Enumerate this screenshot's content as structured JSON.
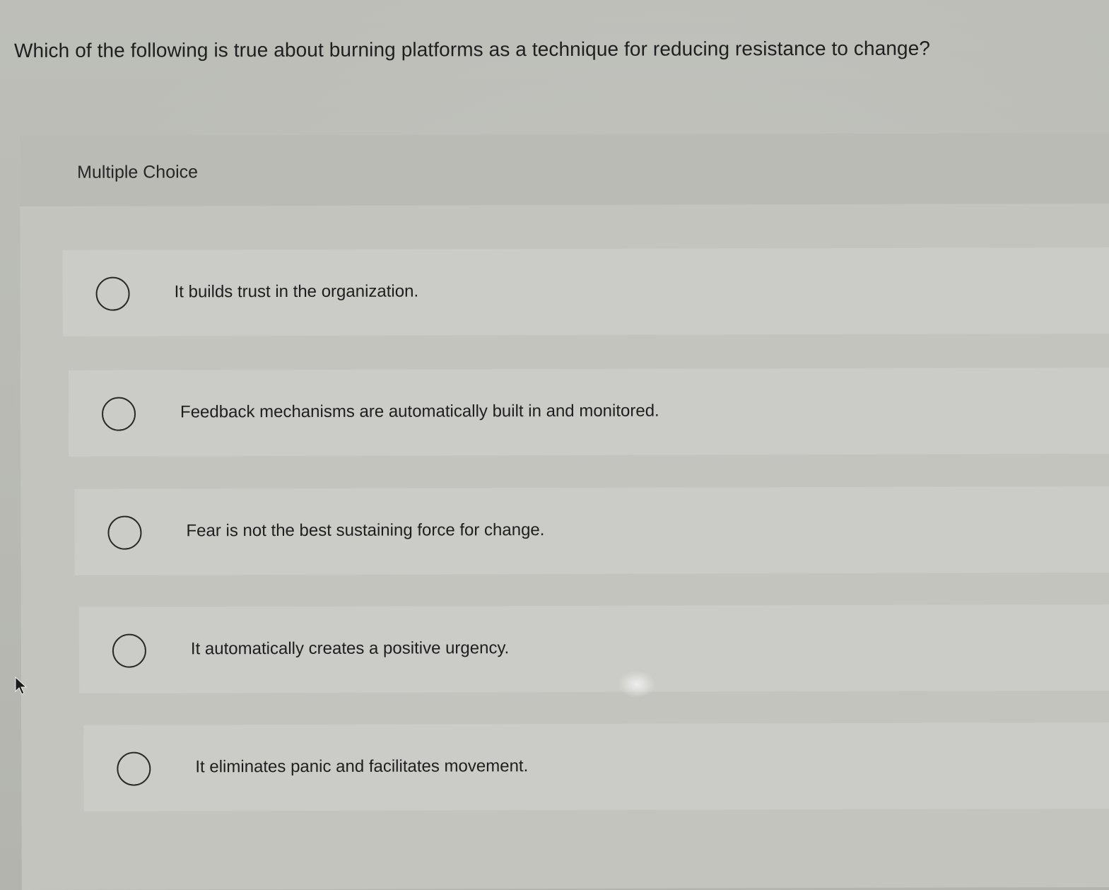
{
  "question": {
    "text": "Which of the following is true about burning platforms as a technique for reducing resistance to change?"
  },
  "multiple_choice": {
    "title": "Multiple Choice",
    "options": [
      {
        "label": "It builds trust in the organization."
      },
      {
        "label": "Feedback mechanisms are automatically built in and monitored."
      },
      {
        "label": "Fear is not the best sustaining force for change."
      },
      {
        "label": "It automatically creates a positive urgency."
      },
      {
        "label": "It eliminates panic and facilitates movement."
      }
    ]
  },
  "icons": {
    "radio": "radio-button-unselected-icon",
    "cursor": "mouse-pointer-icon"
  },
  "colors": {
    "background": "#b7b8b2",
    "panel": "#c3c4be",
    "text": "#1e1e1e"
  }
}
